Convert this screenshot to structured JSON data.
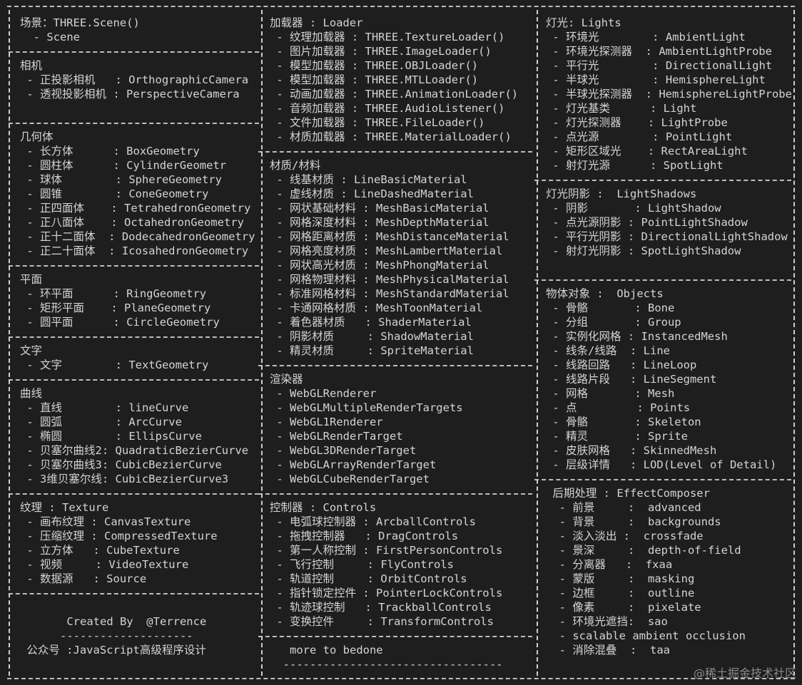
{
  "terminal": {
    "background": "#1e1e1e",
    "foreground": "#d4d4d4"
  },
  "col1": [
    {
      "text": "场景：THREE.Scene()"
    },
    {
      "text": "  - Scene"
    },
    {
      "sep": true
    },
    {
      "text": "相机"
    },
    {
      "text": " - 正投影相机   : OrthographicCamera"
    },
    {
      "text": " - 透视投影相机 : PerspectiveCamera"
    },
    {
      "text": ""
    },
    {
      "sep": true
    },
    {
      "text": "几何体"
    },
    {
      "text": " - 长方体      : BoxGeometry"
    },
    {
      "text": " - 圆柱体      : CylinderGeometr"
    },
    {
      "text": " - 球体        : SphereGeometry"
    },
    {
      "text": " - 圆锥        : ConeGeometry"
    },
    {
      "text": " - 正四面体    : TetrahedronGeometry"
    },
    {
      "text": " - 正八面体    : OctahedronGeometry"
    },
    {
      "text": " - 正十二面体  : DodecahedronGeometry"
    },
    {
      "text": " - 正二十面体  : IcosahedronGeometry"
    },
    {
      "sep": true
    },
    {
      "text": "平面"
    },
    {
      "text": " - 环平面      : RingGeometry"
    },
    {
      "text": " - 矩形平面    : PlaneGeometry"
    },
    {
      "text": " - 圆平面      : CircleGeometry"
    },
    {
      "sep": true
    },
    {
      "text": "文字"
    },
    {
      "text": " - 文字        : TextGeometry"
    },
    {
      "sep": true
    },
    {
      "text": "曲线"
    },
    {
      "text": " - 直线        : lineCurve"
    },
    {
      "text": " - 圆弧        : ArcCurve"
    },
    {
      "text": " - 椭圆        : EllipsCurve"
    },
    {
      "text": " - 贝塞尔曲线2: QuadraticBezierCurve"
    },
    {
      "text": " - 贝塞尔曲线3: CubicBezierCurve"
    },
    {
      "text": " - 3维贝塞尔线: CubicBezierCurve3"
    },
    {
      "sep": true
    },
    {
      "text": "纹理 : Texture"
    },
    {
      "text": " - 画布纹理 : CanvasTexture"
    },
    {
      "text": " - 压缩纹理 : CompressedTexture"
    },
    {
      "text": " - 立方体   : CubeTexture"
    },
    {
      "text": " - 视频     : VideoTexture"
    },
    {
      "text": " - 数据源   : Source"
    },
    {
      "sep": true
    },
    {
      "text": ""
    },
    {
      "text": "       Created By  @Terrence"
    },
    {
      "text": "      --------------------"
    },
    {
      "text": " 公众号 :JavaScript高级程序设计"
    }
  ],
  "col2": [
    {
      "text": "加载器 : Loader"
    },
    {
      "text": " - 纹理加载器 : THREE.TextureLoader()"
    },
    {
      "text": " - 图片加载器 : THREE.ImageLoader()"
    },
    {
      "text": " - 模型加载器 : THREE.OBJLoader()"
    },
    {
      "text": " - 模型加载器 : THREE.MTLLoader()"
    },
    {
      "text": " - 动画加载器 : THREE.AnimationLoader()"
    },
    {
      "text": " - 音频加载器 : THREE.AudioListener()"
    },
    {
      "text": " - 文件加载器 : THREE.FileLoader()"
    },
    {
      "text": " - 材质加载器 : THREE.MaterialLoader()"
    },
    {
      "sep": true
    },
    {
      "text": "材质/材料"
    },
    {
      "text": " - 线基材质 : LineBasicMaterial"
    },
    {
      "text": " - 虚线材质 : LineDashedMaterial"
    },
    {
      "text": " - 网状基础材料 : MeshBasicMaterial"
    },
    {
      "text": " - 网格深度材料 : MeshDepthMaterial"
    },
    {
      "text": " - 网格距离材质 : MeshDistanceMaterial"
    },
    {
      "text": " - 网格亮度材质 : MeshLambertMaterial"
    },
    {
      "text": " - 网状高光材质 : MeshPhongMaterial"
    },
    {
      "text": " - 网格物理材料 : MeshPhysicalMaterial"
    },
    {
      "text": " - 标准网格材料 : MeshStandardMaterial"
    },
    {
      "text": " - 卡通网格材质 : MeshToonMaterial"
    },
    {
      "text": " - 着色器材质   : ShaderMaterial"
    },
    {
      "text": " - 阴影材质     : ShadowMaterial"
    },
    {
      "text": " - 精灵材质     : SpriteMaterial"
    },
    {
      "sep": true
    },
    {
      "text": "渲染器"
    },
    {
      "text": " - WebGLRenderer"
    },
    {
      "text": " - WebGLMultipleRenderTargets"
    },
    {
      "text": " - WebGL1Renderer"
    },
    {
      "text": " - WebGLRenderTarget"
    },
    {
      "text": " - WebGL3DRenderTarget"
    },
    {
      "text": " - WebGLArrayRenderTarget"
    },
    {
      "text": " - WebGLCubeRenderTarget"
    },
    {
      "sep": true
    },
    {
      "text": "控制器 : Controls"
    },
    {
      "text": " - 电弧球控制器 : ArcballControls"
    },
    {
      "text": " - 拖拽控制器   : DragControls"
    },
    {
      "text": " - 第一人称控制 : FirstPersonControls"
    },
    {
      "text": " - 飞行控制     : FlyControls"
    },
    {
      "text": " - 轨道控制     : OrbitControls"
    },
    {
      "text": " - 指针锁定控件 : PointerLockControls"
    },
    {
      "text": " - 轨迹球控制   : TrackballControls"
    },
    {
      "text": " - 变换控件     : TransformControls"
    },
    {
      "sep": true
    },
    {
      "text": "   more to bedone"
    },
    {
      "text": "  ---------------------------------"
    }
  ],
  "col3": [
    {
      "text": "灯光: Lights"
    },
    {
      "text": " - 环境光        : AmbientLight"
    },
    {
      "text": " - 环境光探测器  : AmbientLightProbe"
    },
    {
      "text": " - 平行光        : DirectionalLight"
    },
    {
      "text": " - 半球光        : HemisphereLight"
    },
    {
      "text": " - 半球光探测器  : HemisphereLightProbe"
    },
    {
      "text": " - 灯光基类      : Light"
    },
    {
      "text": " - 灯光探测器    : LightProbe"
    },
    {
      "text": " - 点光源        : PointLight"
    },
    {
      "text": " - 矩形区域光    : RectAreaLight"
    },
    {
      "text": " - 射灯光源      : SpotLight"
    },
    {
      "sep": true
    },
    {
      "text": "灯光阴影 :  LightShadows"
    },
    {
      "text": " - 阴影       : LightShadow"
    },
    {
      "text": " - 点光源阴影 : PointLightShadow"
    },
    {
      "text": " - 平行光阴影 : DirectionalLightShadow"
    },
    {
      "text": " - 射灯光阴影 : SpotLightShadow"
    },
    {
      "text": ""
    },
    {
      "sep": true
    },
    {
      "text": "物体对象 :  Objects"
    },
    {
      "text": " - 骨骼       : Bone"
    },
    {
      "text": " - 分组       : Group"
    },
    {
      "text": " - 实例化网格 : InstancedMesh"
    },
    {
      "text": " - 线条/线路  : Line"
    },
    {
      "text": " - 线路回路   : LineLoop"
    },
    {
      "text": " - 线路片段   : LineSegment"
    },
    {
      "text": " - 网格       : Mesh"
    },
    {
      "text": " - 点         : Points"
    },
    {
      "text": " - 骨骼       : Skeleton"
    },
    {
      "text": " - 精灵       : Sprite"
    },
    {
      "text": " - 皮肤网格   : SkinnedMesh"
    },
    {
      "text": " - 层级详情   : LOD(Level of Detail)"
    },
    {
      "sep": true
    },
    {
      "text": " 后期处理 : EffectComposer"
    },
    {
      "text": "  - 前景     :  advanced"
    },
    {
      "text": "  - 背景     :  backgrounds"
    },
    {
      "text": "  - 淡入淡出 :  crossfade"
    },
    {
      "text": "  - 景深     :  depth-of-field"
    },
    {
      "text": "  - 分离器   :  fxaa"
    },
    {
      "text": "  - 蒙版     :  masking"
    },
    {
      "text": "  - 边框     :  outline"
    },
    {
      "text": "  - 像素     :  pixelate"
    },
    {
      "text": "  - 环境光遮挡:  sao"
    },
    {
      "text": "  - scalable ambient occlusion"
    },
    {
      "text": "  - 消除混叠  :  taa"
    }
  ],
  "watermark": "@稀土掘金技术社区"
}
